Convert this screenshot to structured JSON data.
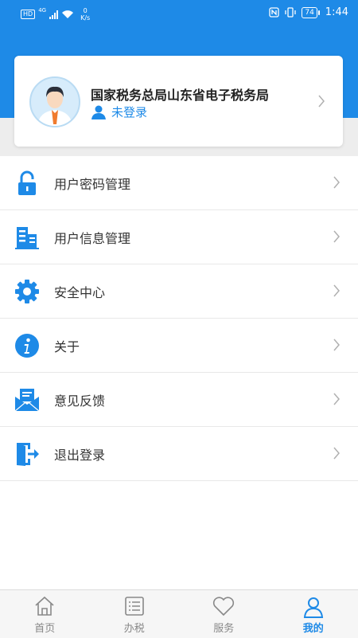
{
  "status_bar": {
    "left_badges": [
      "HD",
      "4G"
    ],
    "speed_value": "0",
    "speed_unit": "K/s",
    "battery": "74",
    "time": "1:44"
  },
  "profile": {
    "org_name": "国家税务总局山东省电子税务局",
    "login_status": "未登录"
  },
  "menu": {
    "items": [
      {
        "label": "用户密码管理",
        "icon": "lock-icon"
      },
      {
        "label": "用户信息管理",
        "icon": "building-icon"
      },
      {
        "label": "安全中心",
        "icon": "gear-icon"
      },
      {
        "label": "关于",
        "icon": "info-icon"
      },
      {
        "label": "意见反馈",
        "icon": "mail-feedback-icon"
      },
      {
        "label": "退出登录",
        "icon": "exit-icon"
      }
    ]
  },
  "bottom_nav": {
    "items": [
      {
        "label": "首页",
        "icon": "home-icon",
        "active": false
      },
      {
        "label": "办税",
        "icon": "list-icon",
        "active": false
      },
      {
        "label": "服务",
        "icon": "heart-icon",
        "active": false
      },
      {
        "label": "我的",
        "icon": "person-icon",
        "active": true
      }
    ]
  },
  "colors": {
    "accent": "#1e8ae7",
    "background_band": "#ededed",
    "text": "#333333",
    "inactive_nav": "#888888"
  }
}
